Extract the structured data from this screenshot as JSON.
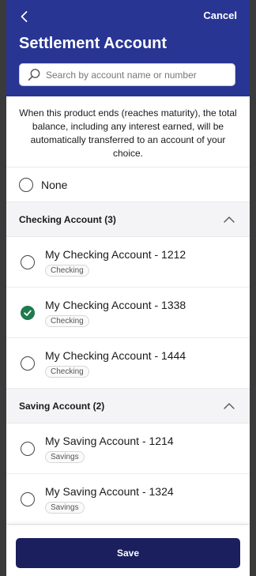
{
  "header": {
    "cancel_label": "Cancel",
    "title": "Settlement Account",
    "search_placeholder": "Search by account name or number"
  },
  "description": "When this product ends (reaches maturity), the total balance, including any interest earned, will be automatically transferred to an account of your choice.",
  "none_option": {
    "label": "None",
    "selected": false
  },
  "sections": [
    {
      "title": "Checking Account (3)",
      "expanded": true,
      "accounts": [
        {
          "name": "My Checking Account - 1212",
          "type": "Checking",
          "selected": false
        },
        {
          "name": "My Checking Account - 1338",
          "type": "Checking",
          "selected": true
        },
        {
          "name": "My Checking Account - 1444",
          "type": "Checking",
          "selected": false
        }
      ]
    },
    {
      "title": "Saving Account (2)",
      "expanded": true,
      "accounts": [
        {
          "name": "My Saving Account - 1214",
          "type": "Savings",
          "selected": false
        },
        {
          "name": "My Saving Account - 1324",
          "type": "Savings",
          "selected": false
        }
      ]
    }
  ],
  "footer": {
    "save_label": "Save"
  },
  "colors": {
    "header_bg": "#283593",
    "save_bg": "#1b1f5e",
    "selected_green": "#1f7a4d"
  }
}
